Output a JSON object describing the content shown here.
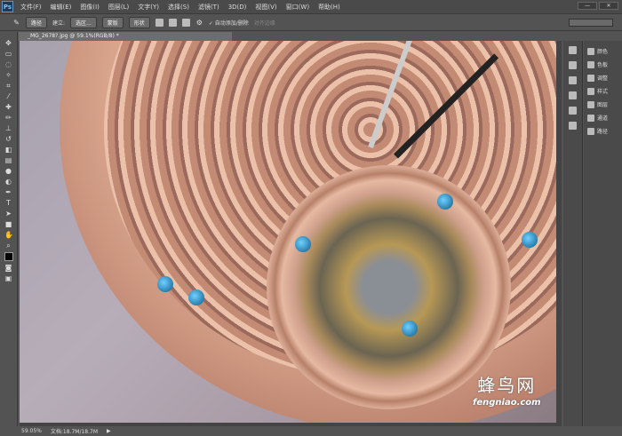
{
  "app": {
    "logo": "Ps"
  },
  "menu": [
    "文件(F)",
    "编辑(E)",
    "图像(I)",
    "图层(L)",
    "文字(Y)",
    "选择(S)",
    "滤镜(T)",
    "3D(D)",
    "视图(V)",
    "窗口(W)",
    "帮助(H)"
  ],
  "window_buttons": [
    "—",
    "✕"
  ],
  "options": {
    "mode": "路径",
    "make_label": "建立:",
    "selection": "选区...",
    "mask": "蒙版",
    "shape": "形状",
    "auto_add": "自动添加/删除",
    "align_edges": "对齐边缘"
  },
  "document_tab": "_MG_2678?.jpg @ 59.1%(RGB/8) *",
  "panels": [
    "颜色",
    "色板",
    "调整",
    "样式",
    "图层",
    "通道",
    "路径"
  ],
  "status": {
    "zoom": "59.05%",
    "doc": "文档:18.7M/18.7M"
  },
  "watermark": {
    "brand": "蜂鸟网",
    "url": "fengniao.com"
  }
}
